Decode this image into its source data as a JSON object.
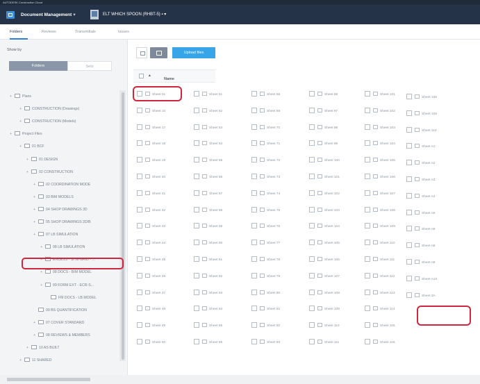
{
  "topbar": {
    "text": "AUTODESK Construction Cloud"
  },
  "header": {
    "app_title": "Document Management",
    "project_name": "ELT WHICH SPOON (RHBT-5)"
  },
  "tabs": [
    "Folders",
    "Reviews",
    "Transmittals",
    "Issues"
  ],
  "sidebar": {
    "show_by_label": "Show by",
    "segments": [
      "Folders",
      "Sets"
    ],
    "tree": [
      "Plans",
      "CONSTRUCTION (Drawings)",
      "CONSTRUCTION (Models)",
      "Project Files",
      "01 BCF",
      "01 DESIGN",
      "02 CONSTRUCTION",
      "02 COORDINATION MODE",
      "03 BIM MODELS",
      "04 SHOP DRAWINGS 3D",
      "05 SHOP DRAWINGS 2D/B",
      "07 LB SIMULATION",
      "08 LB SIMULATION",
      "EXCESS - SITE-GRID - ...",
      "08 DOCS - BIM MODEL",
      "09 FORM EXT - ECR-S...",
      "FM DOCS - LB MODEL",
      "09 BS QUANTIFICATION",
      "07 COVER STANDARD",
      "08 REVIEWS & MEMBERS",
      "10 AS BUILT",
      "11 SHARED"
    ]
  },
  "toolbar": {
    "upload_label": "Upload files"
  },
  "file_list": {
    "header": "Name",
    "columns": [
      [
        "Sheet 01",
        "Sheet 10",
        "Sheet 17",
        "Sheet 18",
        "Sheet 19",
        "Sheet 40",
        "Sheet 41",
        "Sheet 42",
        "Sheet 43",
        "Sheet 44",
        "Sheet 45",
        "Sheet 46",
        "Sheet 47",
        "Sheet 48",
        "Sheet 49",
        "Sheet 50"
      ],
      [
        "Sheet 51",
        "Sheet 52",
        "Sheet 53",
        "Sheet 54",
        "Sheet 55",
        "Sheet 56",
        "Sheet 57",
        "Sheet 58",
        "Sheet 59",
        "Sheet 60",
        "Sheet 61",
        "Sheet 62",
        "Sheet 63",
        "Sheet 64",
        "Sheet 65",
        "Sheet 66"
      ],
      [
        "Sheet 68",
        "Sheet 69",
        "Sheet 70",
        "Sheet 71",
        "Sheet 72",
        "Sheet 73",
        "Sheet 74",
        "Sheet 75",
        "Sheet 76",
        "Sheet 77",
        "Sheet 78",
        "Sheet 79",
        "Sheet 80",
        "Sheet 81",
        "Sheet 82",
        "Sheet 83"
      ],
      [
        "Sheet 89",
        "Sheet 97",
        "Sheet 98",
        "Sheet 99",
        "Sheet 100",
        "Sheet 101",
        "Sheet 102",
        "Sheet 103",
        "Sheet 104",
        "Sheet 105",
        "Sheet 106",
        "Sheet 107",
        "Sheet 108",
        "Sheet 109",
        "Sheet 110",
        "Sheet 111"
      ],
      [
        "Sheet 101",
        "Sheet 102",
        "Sheet 103",
        "Sheet 104",
        "Sheet 105",
        "Sheet 106",
        "Sheet 107",
        "Sheet 108",
        "Sheet 109",
        "Sheet 110",
        "Sheet 111",
        "Sheet 112",
        "Sheet 113",
        "Sheet 114",
        "Sheet 115",
        "Sheet 116"
      ],
      [
        "Sheet 108",
        "Sheet 109",
        "Sheet 110",
        "Sheet A1",
        "Sheet A2",
        "Sheet A3",
        "Sheet A4",
        "Sheet A5",
        "Sheet A6",
        "Sheet A8",
        "Sheet A9",
        "Sheet A10",
        "Sheet 3A"
      ]
    ]
  }
}
